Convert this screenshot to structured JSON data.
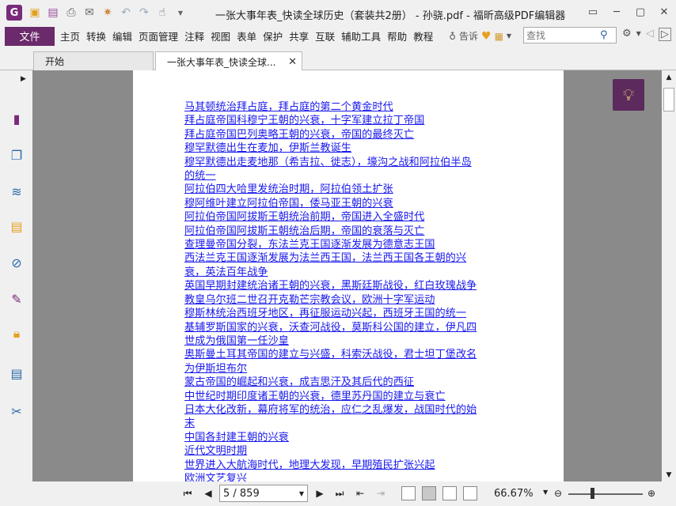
{
  "titlebar": {
    "app_logo": "G",
    "title": "一张大事年表_快读全球历史（套装共2册） - 孙骁.pdf - 福昕高级PDF编辑器",
    "quick_access": [
      "open-folder-icon",
      "save-icon",
      "print-icon",
      "email-icon",
      "new-icon",
      "undo-icon",
      "redo-icon",
      "hand-tool-icon"
    ],
    "window_controls": [
      "ribbon-toggle-icon",
      "minimize-icon",
      "maximize-icon",
      "close-icon"
    ]
  },
  "menubar": {
    "file": "文件",
    "items": [
      "主页",
      "转换",
      "编辑",
      "页面管理",
      "注释",
      "视图",
      "表单",
      "保护",
      "共享",
      "互联",
      "辅助工具",
      "帮助",
      "教程"
    ],
    "tell_me": "告诉",
    "search_placeholder": "查找"
  },
  "tabs": [
    {
      "label": "开始",
      "active": false
    },
    {
      "label": "一张大事年表_快读全球...",
      "active": true
    }
  ],
  "sidebar": [
    "page-thumbnail-icon",
    "pages-icon",
    "layers-icon",
    "comments-icon",
    "attachments-icon",
    "signature-icon",
    "security-icon",
    "form-fields-icon",
    "tools-icon"
  ],
  "toc": [
    "马其顿统治拜占庭，拜占庭的第二个黄金时代",
    "拜占庭帝国科穆宁王朝的兴衰，十字军建立拉丁帝国",
    "拜占庭帝国巴列奥略王朝的兴衰，帝国的最终灭亡",
    "穆罕默德出生在麦加，伊斯兰教诞生",
    "穆罕默德出走麦地那（希吉拉、徙志），壕沟之战和阿拉伯半岛",
    "的统一",
    "阿拉伯四大哈里发统治时期，阿拉伯领土扩张",
    "穆阿维叶建立阿拉伯帝国，倭马亚王朝的兴衰",
    "阿拉伯帝国阿拔斯王朝统治前期，帝国进入全盛时代",
    "阿拉伯帝国阿拔斯王朝统治后期，帝国的衰落与灭亡",
    "查理曼帝国分裂，东法兰克王国逐渐发展为德意志王国",
    "西法兰克王国逐渐发展为法兰西王国，法兰西王国各王朝的兴",
    "衰，英法百年战争",
    "英国早期封建统治诸王朝的兴衰，黑斯廷斯战役，红白玫瑰战争",
    "教皇乌尔班二世召开克勒芒宗教会议，欧洲十字军运动",
    "穆斯林统治西班牙地区，再征服运动兴起，西班牙王国的统一",
    "基辅罗斯国家的兴衰，沃查河战役，莫斯科公国的建立，伊凡四",
    "世成为俄国第一任沙皇",
    "奥斯曼土耳其帝国的建立与兴盛，科索沃战役，君士坦丁堡改名",
    "为伊斯坦布尔",
    "蒙古帝国的崛起和兴衰，成吉思汗及其后代的西征",
    "中世纪时期印度诸王朝的兴衰，德里苏丹国的建立与衰亡",
    "日本大化改新，幕府将军的统治，应仁之乱爆发，战国时代的始",
    "末",
    "中国各封建王朝的兴衰",
    "近代文明时期",
    "世界进入大航海时代，地理大发现，早期殖民扩张兴起",
    "欧洲文艺复兴"
  ],
  "statusbar": {
    "page_value": "5 / 859",
    "zoom": "66.67%"
  }
}
